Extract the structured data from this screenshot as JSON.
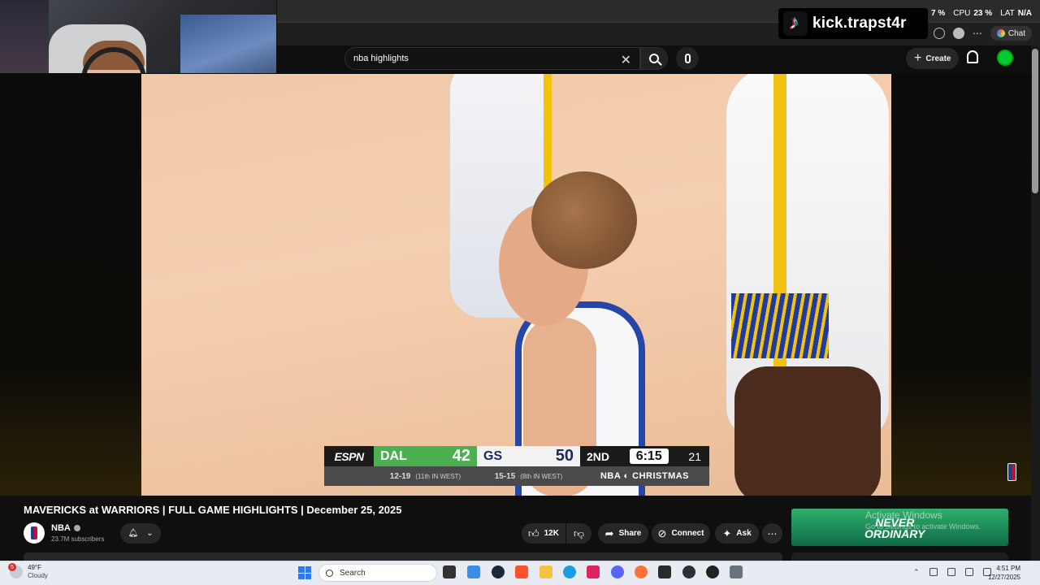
{
  "stats": {
    "gpu_value": "7 %",
    "cpu_label": "CPU",
    "cpu_value": "23 %",
    "lat_label": "LAT",
    "lat_value": "N/A"
  },
  "overlay": {
    "kick_handle": "kick.trapst4r"
  },
  "browser": {
    "chat_label": "Chat"
  },
  "header": {
    "search_value": "nba highlights",
    "create_label": "Create"
  },
  "scorebug": {
    "network": "ESPN",
    "away_team": "DAL",
    "away_score": "42",
    "home_team": "GS",
    "home_score": "50",
    "quarter": "2ND",
    "clock": "6:15",
    "shot_clock": "21",
    "away_record": "12-19",
    "away_rank": "(11th IN WEST)",
    "home_record": "15-15",
    "home_rank": "(8th IN WEST)",
    "brand": "NBA ◐ CHRISTMAS"
  },
  "video": {
    "title": "MAVERICKS at WARRIORS | FULL GAME HIGHLIGHTS | December 25, 2025",
    "channel_name": "NBA",
    "subscribers": "23.7M subscribers",
    "like_count": "12K",
    "share_label": "Share",
    "connect_label": "Connect",
    "ask_label": "Ask"
  },
  "ad": {
    "line1": "NEVER",
    "line2": "ORDINARY",
    "activate_title": "Activate Windows",
    "activate_sub": "Go to Settings to activate Windows."
  },
  "taskbar": {
    "weather_badge": "5",
    "temperature": "49°F",
    "condition": "Cloudy",
    "search_label": "Search",
    "time": "4:51 PM",
    "date": "12/27/2025"
  },
  "colors": {
    "dal_green": "#4caf50",
    "gs_navy": "#1b2a5a",
    "warriors_gold": "#f3c113",
    "yt_bg": "#0f0f0f"
  }
}
